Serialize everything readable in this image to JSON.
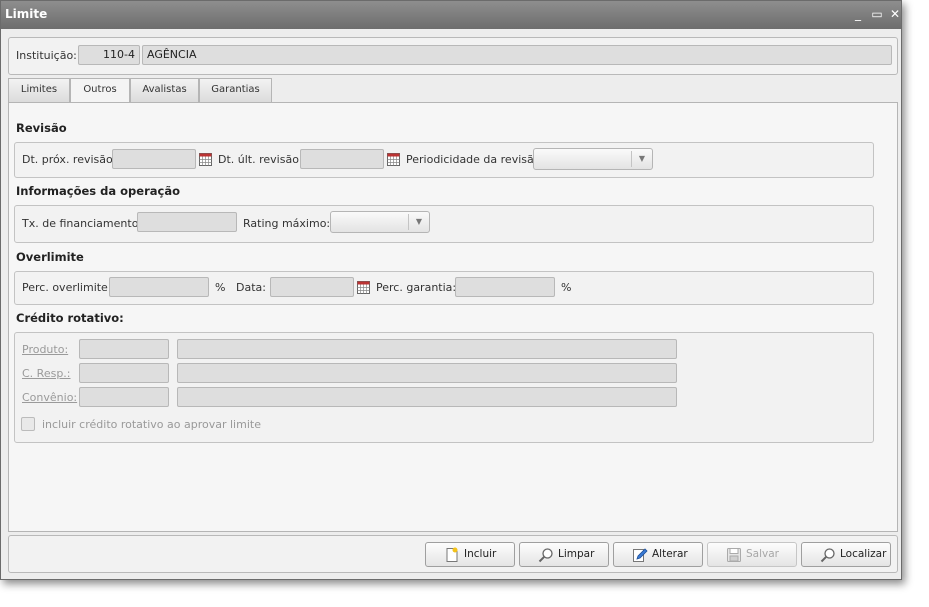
{
  "window": {
    "title": "Limite",
    "minimize": "_",
    "maximize": "▭",
    "close": "✕"
  },
  "instituicao": {
    "label": "Instituição:",
    "code": "110-4",
    "name": "AGÊNCIA"
  },
  "tabs": [
    {
      "label": "Limites"
    },
    {
      "label": "Outros"
    },
    {
      "label": "Avalistas"
    },
    {
      "label": "Garantias"
    }
  ],
  "revisao": {
    "title": "Revisão",
    "dt_prox_label": "Dt. próx. revisão:",
    "dt_prox_value": "",
    "dt_ult_label": "Dt. últ. revisão:",
    "dt_ult_value": "",
    "periodicidade_label": "Periodicidade da revisão:",
    "periodicidade_value": ""
  },
  "operacao": {
    "title": "Informações da operação",
    "tx_label": "Tx. de financiamento:",
    "tx_value": "",
    "rating_label": "Rating máximo:",
    "rating_value": ""
  },
  "overlimite": {
    "title": "Overlimite",
    "perc_label": "Perc. overlimite:",
    "perc_value": "",
    "perc_unit": "%",
    "data_label": "Data:",
    "data_value": "",
    "garantia_label": "Perc. garantia:",
    "garantia_value": "",
    "garantia_unit": "%"
  },
  "credito": {
    "title": "Crédito rotativo:",
    "produto_label": "Produto:",
    "cresp_label": "C. Resp.:",
    "convenio_label": "Convênio:",
    "checkbox_label": "incluir crédito rotativo ao aprovar limite"
  },
  "buttons": {
    "incluir": "Incluir",
    "limpar": "Limpar",
    "alterar": "Alterar",
    "salvar": "Salvar",
    "localizar": "Localizar"
  }
}
